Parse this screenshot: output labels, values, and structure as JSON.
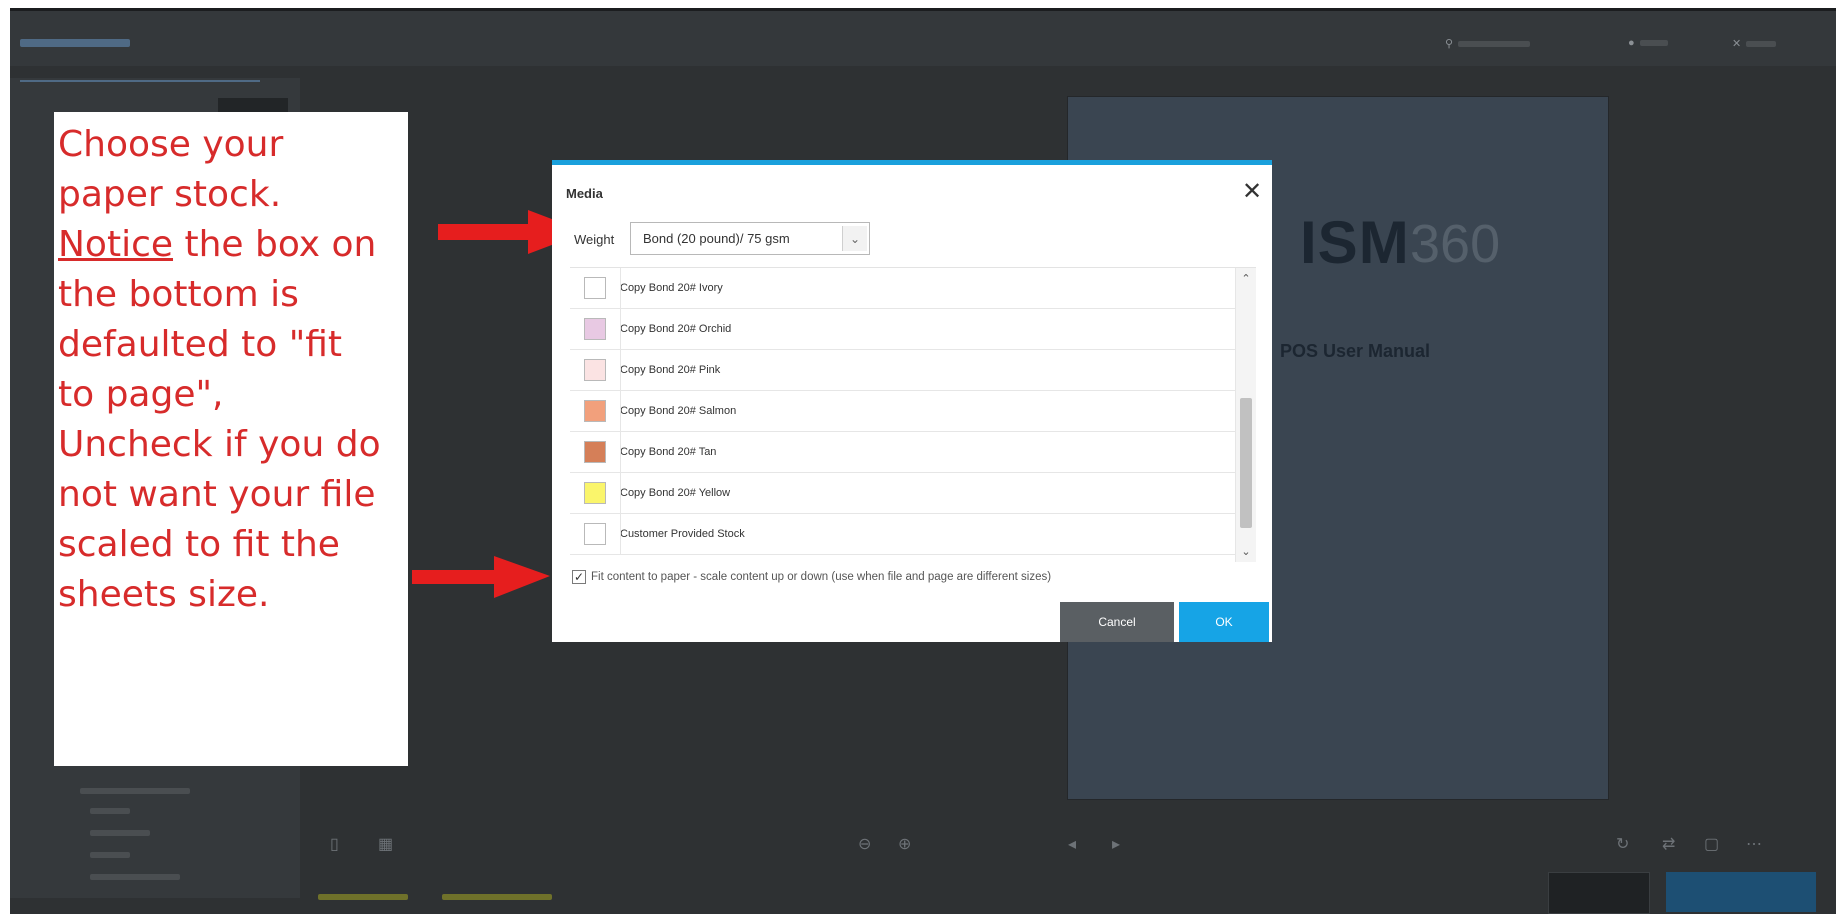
{
  "annotation": {
    "lines": [
      "Choose your",
      "paper stock.",
      "the box on",
      "the bottom is",
      "defaulted to \"fit",
      "to page\",",
      "Uncheck if you do",
      "not want your file",
      "scaled to fit the",
      "sheets size."
    ],
    "underlined_word": "Notice"
  },
  "modal": {
    "title": "Media",
    "close_icon": "close-icon",
    "weight_label": "Weight",
    "weight_value": "Bond (20 pound)/ 75 gsm",
    "stocks": [
      {
        "label": "Copy Bond 20# Ivory",
        "color": "#ffffff"
      },
      {
        "label": "Copy Bond 20# Orchid",
        "color": "#e8c9e3"
      },
      {
        "label": "Copy Bond 20# Pink",
        "color": "#fbe3e3"
      },
      {
        "label": "Copy Bond 20# Salmon",
        "color": "#f2a07c"
      },
      {
        "label": "Copy Bond 20# Tan",
        "color": "#d57f58"
      },
      {
        "label": "Copy Bond 20# Yellow",
        "color": "#faf56b"
      },
      {
        "label": "Customer Provided Stock",
        "color": "#ffffff"
      }
    ],
    "fit_label": "Fit content to paper - scale content up or down (use when file and page are different sizes)",
    "fit_checked": true,
    "cancel_label": "Cancel",
    "ok_label": "OK"
  },
  "background": {
    "brand_main": "ISM",
    "brand_number": "360",
    "manual_title": "POS User Manual"
  },
  "colors": {
    "annotation_text": "#d72b2b",
    "arrow": "#e61e1e",
    "modal_accent": "#1aa0dc",
    "ok_button": "#16a4e6",
    "cancel_button": "#5a5f63"
  }
}
